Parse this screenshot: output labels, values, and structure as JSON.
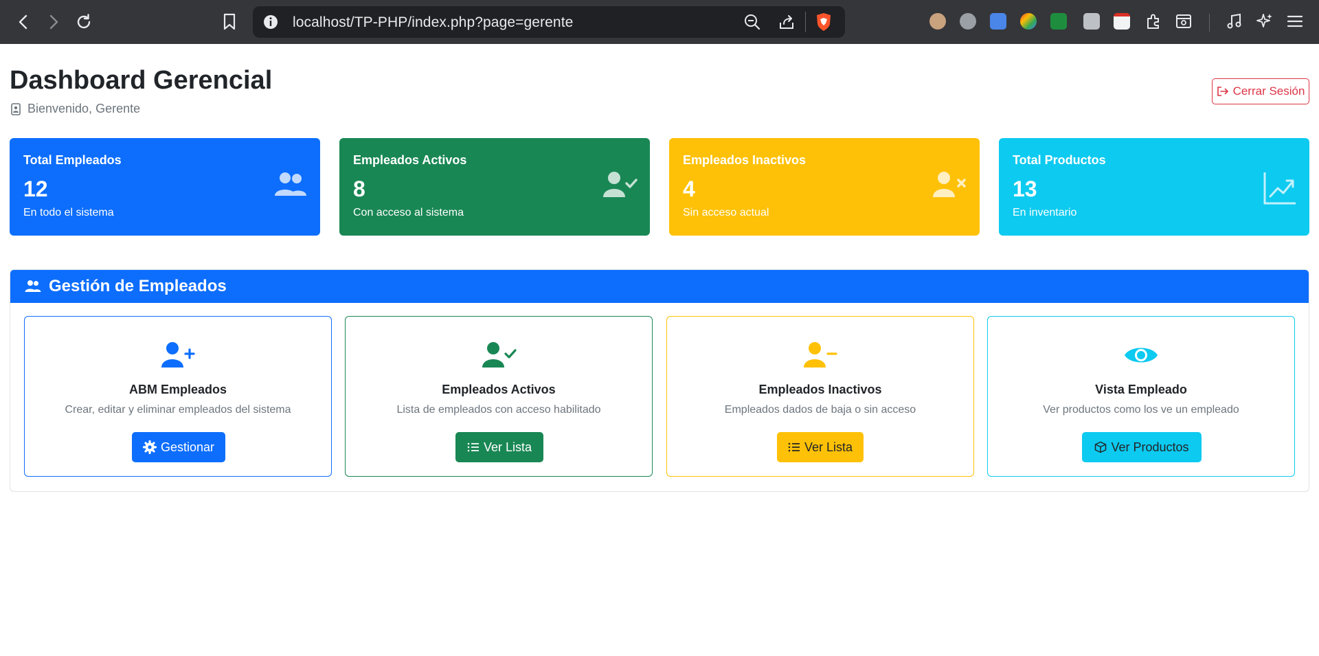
{
  "browser": {
    "url": "localhost/TP-PHP/index.php?page=gerente"
  },
  "header": {
    "title": "Dashboard Gerencial",
    "welcome": "Bienvenido, Gerente",
    "logout_label": "Cerrar Sesión"
  },
  "stats": [
    {
      "label": "Total Empleados",
      "value": "12",
      "desc": "En todo el sistema",
      "color": "#0d6efd",
      "icon": "users-icon"
    },
    {
      "label": "Empleados Activos",
      "value": "8",
      "desc": "Con acceso al sistema",
      "color": "#198754",
      "icon": "user-check-icon"
    },
    {
      "label": "Empleados Inactivos",
      "value": "4",
      "desc": "Sin acceso actual",
      "color": "#ffc107",
      "icon": "user-x-icon"
    },
    {
      "label": "Total Productos",
      "value": "13",
      "desc": "En inventario",
      "color": "#0dcaf0",
      "icon": "chart-line-icon"
    }
  ],
  "management": {
    "title": "Gestión de Empleados",
    "cards": [
      {
        "title": "ABM Empleados",
        "desc": "Crear, editar y eliminar empleados del sistema",
        "button": "Gestionar",
        "color": "#0d6efd",
        "icon": "user-plus-icon"
      },
      {
        "title": "Empleados Activos",
        "desc": "Lista de empleados con acceso habilitado",
        "button": "Ver Lista",
        "color": "#198754",
        "icon": "user-check-icon"
      },
      {
        "title": "Empleados Inactivos",
        "desc": "Empleados dados de baja o sin acceso",
        "button": "Ver Lista",
        "color": "#ffc107",
        "icon": "user-minus-icon"
      },
      {
        "title": "Vista Empleado",
        "desc": "Ver productos como los ve un empleado",
        "button": "Ver Productos",
        "color": "#0dcaf0",
        "icon": "eye-icon"
      }
    ]
  }
}
